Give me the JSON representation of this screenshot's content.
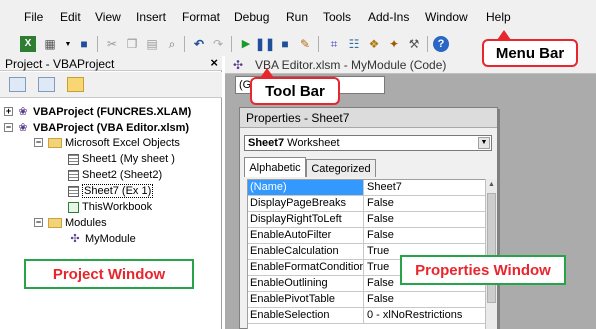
{
  "menubar": {
    "items": [
      "File",
      "Edit",
      "View",
      "Insert",
      "Format",
      "Debug",
      "Run",
      "Tools",
      "Add-Ins",
      "Window",
      "Help"
    ]
  },
  "project": {
    "title": "Project - VBAProject",
    "close": "×",
    "tree": [
      "VBAProject (FUNCRES.XLAM)",
      "VBAProject (VBA Editor.xlsm)",
      "Microsoft Excel Objects",
      "Sheet1 (My sheet )",
      "Sheet2 (Sheet2)",
      "Sheet7 (Ex 1)",
      "ThisWorkbook",
      "Modules",
      "MyModule"
    ],
    "label": "Project Window"
  },
  "code": {
    "title": "VBA Editor.xlsm - MyModule (Code)",
    "combo": "(General)"
  },
  "properties": {
    "title": "Properties - Sheet7",
    "object_name": "Sheet7",
    "object_type": "Worksheet",
    "tabs": [
      "Alphabetic",
      "Categorized"
    ],
    "rows": [
      {
        "name": "(Name)",
        "value": "Sheet7"
      },
      {
        "name": "DisplayPageBreaks",
        "value": "False"
      },
      {
        "name": "DisplayRightToLeft",
        "value": "False"
      },
      {
        "name": "EnableAutoFilter",
        "value": "False"
      },
      {
        "name": "EnableCalculation",
        "value": "True"
      },
      {
        "name": "EnableFormatConditions",
        "value": "True"
      },
      {
        "name": "EnableOutlining",
        "value": "False"
      },
      {
        "name": "EnablePivotTable",
        "value": "False"
      },
      {
        "name": "EnableSelection",
        "value": "0 - xlNoRestrictions"
      }
    ],
    "label": "Properties Window"
  },
  "callouts": {
    "menu_bar": "Menu Bar",
    "tool_bar": "Tool Bar"
  },
  "colors": {
    "callout_border": "#e8262d",
    "label_border": "#27a34a",
    "label_text": "#e8262d",
    "selection": "#3399ff"
  }
}
